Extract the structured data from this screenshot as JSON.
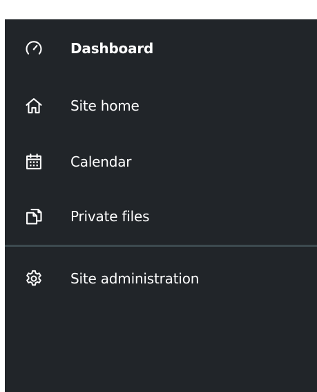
{
  "nav": {
    "items": [
      {
        "label": "Dashboard",
        "icon": "dashboard-icon",
        "active": true
      },
      {
        "label": "Site home",
        "icon": "home-icon",
        "active": false
      },
      {
        "label": "Calendar",
        "icon": "calendar-icon",
        "active": false
      },
      {
        "label": "Private files",
        "icon": "files-icon",
        "active": false
      }
    ],
    "admin_item": {
      "label": "Site administration",
      "icon": "gear-icon"
    }
  },
  "colors": {
    "drawer_background": "#212529",
    "text": "#ffffff",
    "divider": "#3d4a4f",
    "page_background": "#ffffff"
  }
}
